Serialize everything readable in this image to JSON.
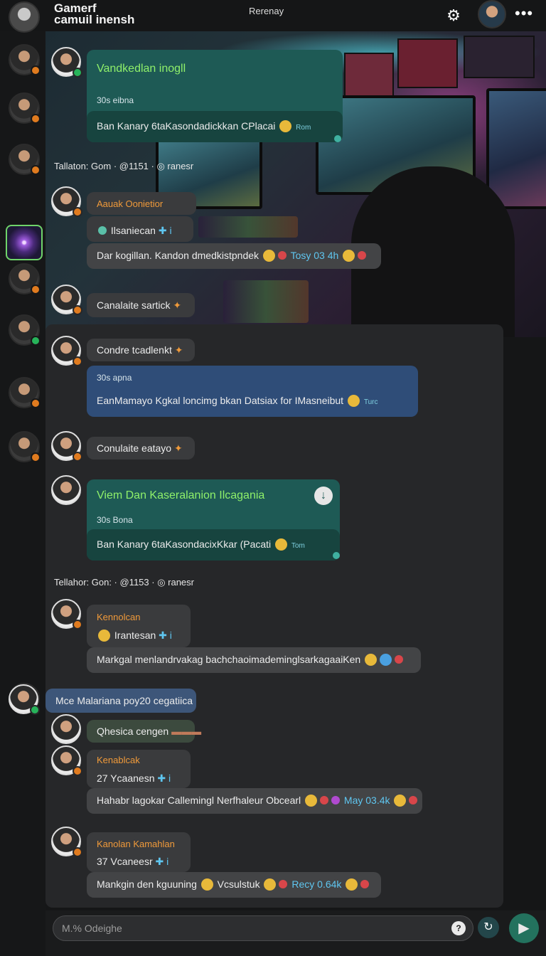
{
  "app": {
    "title": "Gamerf\ncamuil inensh",
    "header_center": "Rerenay"
  },
  "icons": {
    "settings": "gear-icon",
    "more": "more-icon",
    "send": "send-icon",
    "refresh": "refresh-icon",
    "mic": "mic-icon",
    "download": "download-icon"
  },
  "system_lines": [
    "Tallaton: Gom · @1151 · ◎ ranesr",
    "Tellahor: Gon: · @1153 · ◎ ranesr"
  ],
  "messages": {
    "m1": {
      "title": "Vandkedlan inogll",
      "meta": "30s eibna",
      "body": "Ban Kanary 6taKasondadickkan CPlacai",
      "stamp": "Rom"
    },
    "m2": {
      "name": "Aauak Oonietior",
      "sub": "Ilsaniecan",
      "body": "Dar kogillan. Kandon dmedkistpndek",
      "tag": "Tosy 03 4h"
    },
    "m3": {
      "body": "Canalaite sartick"
    },
    "m4": {
      "body": "Condre tcadlenkt"
    },
    "m5": {
      "meta": "30s apna",
      "body": "EanMamayo Kgkal loncimg bkan Datsiax for IMasneibut",
      "stamp": "Turc"
    },
    "m6": {
      "body": "Conulaite eatayo"
    },
    "m7": {
      "title": "Viem Dan Kaseralanion Ilcagania",
      "meta": "30s Bona",
      "body": "Ban Kanary 6taKasondacixKkar (Pacati",
      "stamp": "Tom"
    },
    "m8": {
      "name": "Kennolcan",
      "sub": "Irantesan",
      "body": "Markgal menlandrvakag bachchaoimademinglsarkagaaiKen"
    },
    "m9": {
      "body": "Mce Malariana poy20 cegatiica"
    },
    "m10": {
      "body": "Qhesica cengen"
    },
    "m11": {
      "name": "Kenablcak",
      "sub": "27 Ycaanesn",
      "body": "Hahabr lagokar Callemingl Nerfhaleur Obcearl",
      "tag": "May 03.4k"
    },
    "m12": {
      "name": "Kanolan Kamahlan",
      "sub": "37 Vcaneesr",
      "body": "Mankgin den kguuning",
      "body2": "Vcsulstuk",
      "tag": "Recy 0.64k"
    }
  },
  "composer": {
    "placeholder": "M.% Odeighe"
  },
  "colors": {
    "accent_orange": "#f09a3a",
    "accent_green": "#8ff06a",
    "send_green": "#23725e",
    "teal_bubble": "#1e5a55",
    "blue_bubble": "#2f4d78"
  }
}
